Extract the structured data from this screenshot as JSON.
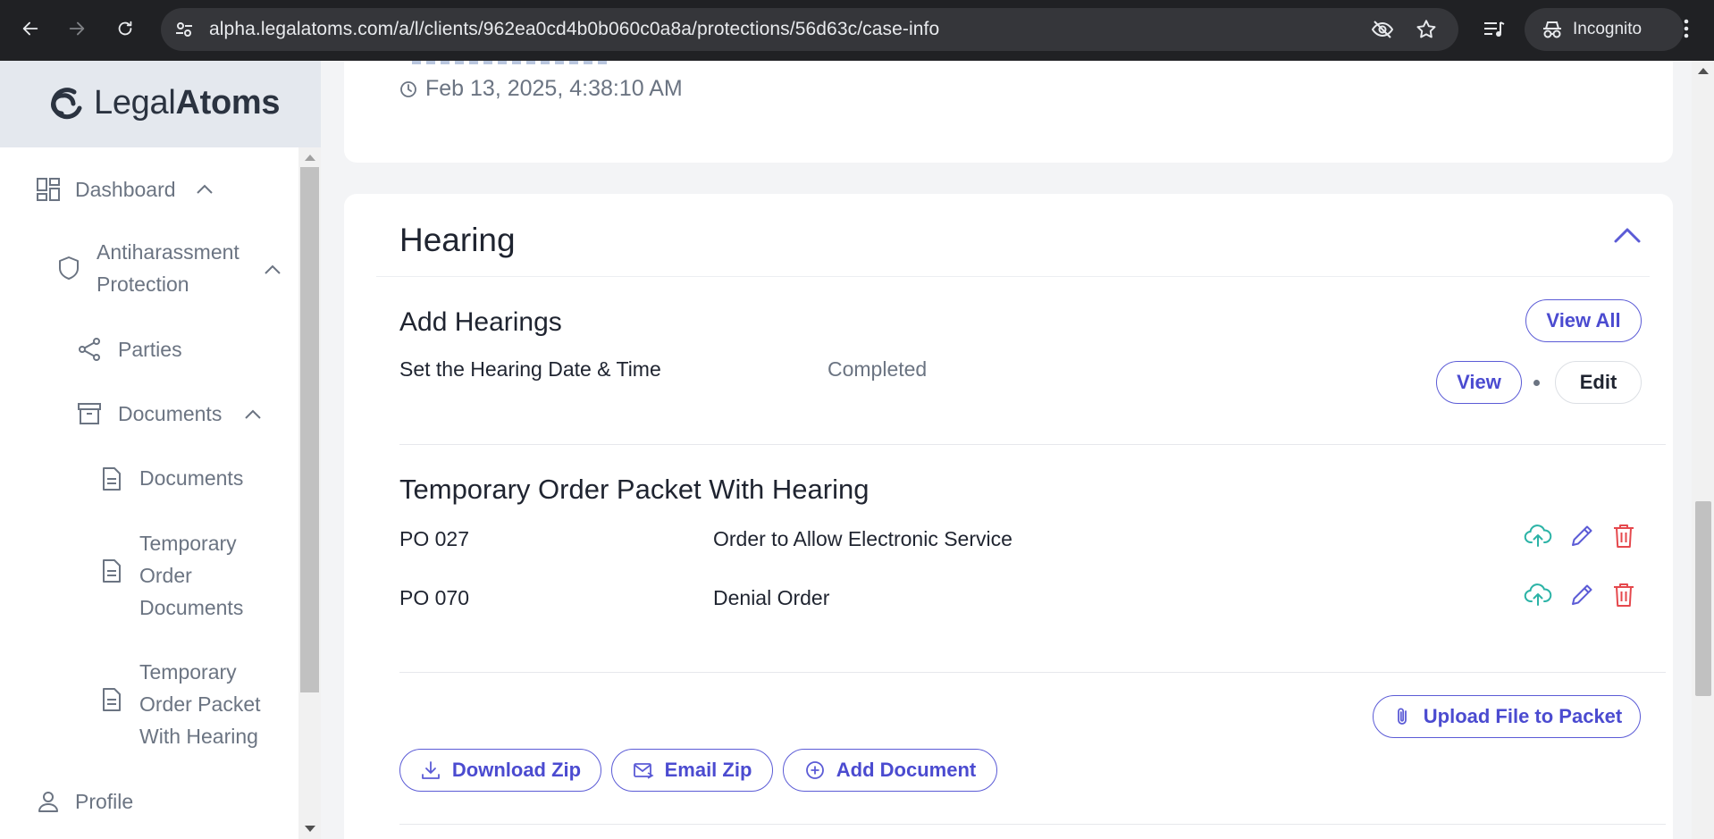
{
  "browser": {
    "url": "alpha.legalatoms.com/a/l/clients/962ea0cd4b0b060c0a8a/protections/56d63c/case-info",
    "profile_label": "Incognito"
  },
  "sidebar": {
    "logo": {
      "light": "Legal",
      "bold": "Atoms"
    },
    "items": [
      {
        "label": "Dashboard",
        "icon": "dashboard-grid-icon"
      },
      {
        "label": "Antiharassment",
        "label2": "Protection",
        "icon": "shield-icon"
      },
      {
        "label": "Parties",
        "icon": "share-icon"
      },
      {
        "label": "Documents",
        "icon": "archive-box-icon"
      },
      {
        "label": "Documents",
        "icon": "file-icon"
      },
      {
        "label": "Temporary",
        "label2": "Order",
        "label3": "Documents",
        "icon": "file-icon"
      },
      {
        "label": "Temporary",
        "label2": "Order Packet",
        "label3": "With Hearing",
        "icon": "file-icon"
      },
      {
        "label": "Profile",
        "icon": "user-icon"
      }
    ]
  },
  "main": {
    "timestamp": "Feb 13, 2025, 4:38:10 AM",
    "hearing": {
      "title": "Hearing",
      "add_hearings": {
        "title": "Add Hearings",
        "view_all_label": "View All",
        "task": "Set the Hearing Date & Time",
        "status": "Completed",
        "view_label": "View",
        "edit_label": "Edit"
      },
      "packet": {
        "title": "Temporary Order Packet With Hearing",
        "rows": [
          {
            "code": "PO 027",
            "name": "Order to Allow Electronic Service"
          },
          {
            "code": "PO 070",
            "name": "Denial Order"
          }
        ],
        "upload_label": "Upload File to Packet",
        "download_zip_label": "Download Zip",
        "email_zip_label": "Email Zip",
        "add_document_label": "Add Document"
      }
    }
  },
  "colors": {
    "accent": "#5b5bd6",
    "upload_icon": "#2bb3a6",
    "delete_icon": "#e5484d",
    "sidebar_text": "#6b7482"
  }
}
